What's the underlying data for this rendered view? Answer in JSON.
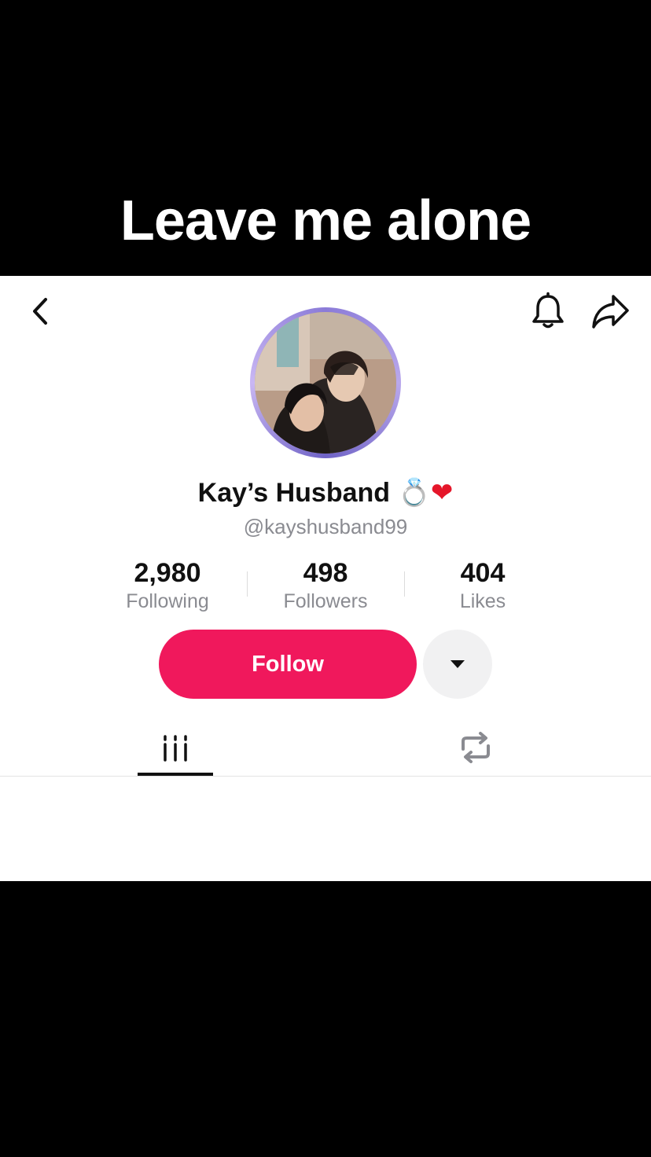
{
  "caption": "Leave me alone",
  "profile": {
    "display_name": "Kay’s Husband",
    "name_emojis": [
      "💍",
      "❤"
    ],
    "username": "@kayshusband99",
    "avatar_icon": "profile-photo"
  },
  "stats": [
    {
      "value": "2,980",
      "label": "Following"
    },
    {
      "value": "498",
      "label": "Followers"
    },
    {
      "value": "404",
      "label": "Likes"
    }
  ],
  "actions": {
    "follow_label": "Follow",
    "more_icon": "caret-down-icon"
  },
  "nav": {
    "back_icon": "chevron-left-icon",
    "bell_icon": "bell-icon",
    "share_icon": "share-arrow-icon"
  },
  "tabs": [
    {
      "icon": "videos-grid-icon",
      "active": true
    },
    {
      "icon": "repost-icon",
      "active": false
    }
  ],
  "colors": {
    "accent": "#f0185c",
    "text_primary": "#111111",
    "text_secondary": "#8a8b91",
    "avatar_ring": "#8b7bd8",
    "background": "#ffffff",
    "letterbox": "#000000"
  }
}
